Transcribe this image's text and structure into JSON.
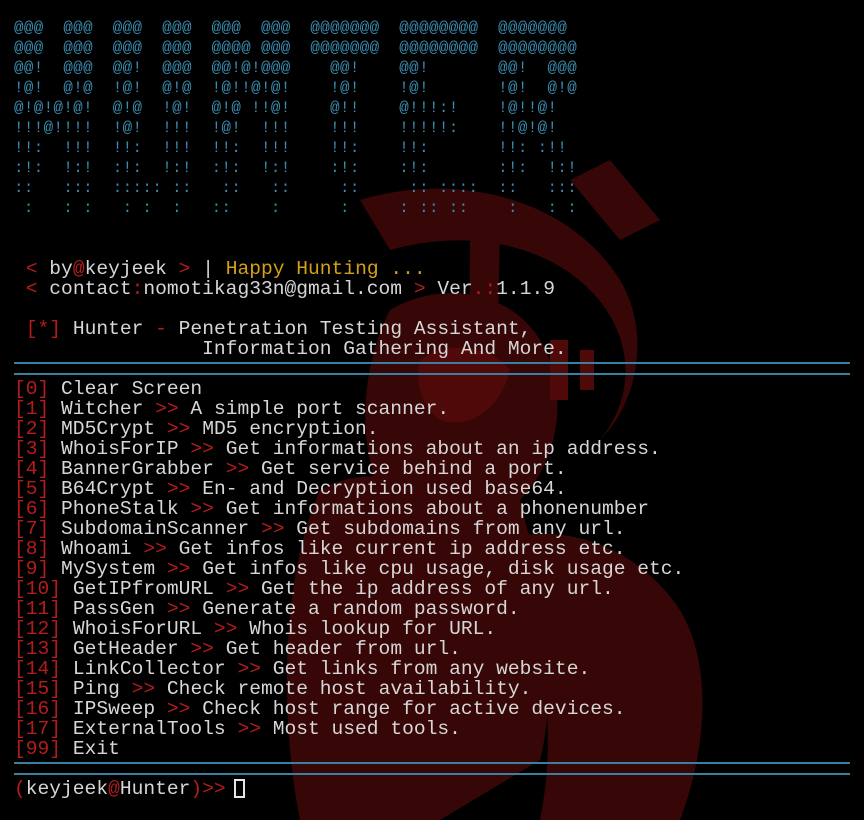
{
  "banner": {
    "lines": [
      "@@@  @@@  @@@  @@@  @@@  @@@  @@@@@@@  @@@@@@@@  @@@@@@@ ",
      "@@@  @@@  @@@  @@@  @@@@ @@@  @@@@@@@  @@@@@@@@  @@@@@@@@",
      "@@!  @@@  @@!  @@@  @@!@!@@@    @@!    @@!       @@!  @@@",
      "!@!  @!@  !@!  @!@  !@!!@!@!    !@!    !@!       !@!  @!@",
      "@!@!@!@!  @!@  !@!  @!@ !!@!    @!!    @!!!:!    !@!!@!  ",
      "!!!@!!!!  !@!  !!!  !@!  !!!    !!!    !!!!!:    !!@!@!  ",
      "!!:  !!!  !!:  !!!  !!:  !!!    !!:    !!:       !!: :!! ",
      ":!:  !:!  :!:  !:!  :!:  !:!    :!:    :!:       :!:  !:!",
      "::   :::  ::::: ::   ::   ::     ::     :: ::::  ::   :::",
      " :   : :   : :  :   ::    :      :     : :: ::    :   : :"
    ]
  },
  "info": {
    "lt": "<",
    "by": "by",
    "at": "@",
    "author": "keyjeek",
    "gt": ">",
    "pipe": "|",
    "tagline": "Happy Hunting ...",
    "contact_label": "contact",
    "colon": ":",
    "email": "nomotikag33n@gmail.com",
    "ver_label": "Ver",
    "ver_sep": ".:",
    "version": "1.1.9"
  },
  "description": {
    "marker": "[*]",
    "name": "Hunter",
    "dash": "-",
    "line1": "Penetration Testing Assistant,",
    "line2": "Information Gathering And More."
  },
  "menu": {
    "items": [
      {
        "num": "[0]",
        "label": "Clear Screen",
        "arrow": "",
        "desc": ""
      },
      {
        "num": "[1]",
        "label": "Witcher",
        "arrow": ">>",
        "desc": "A simple port scanner."
      },
      {
        "num": "[2]",
        "label": "MD5Crypt",
        "arrow": ">>",
        "desc": "MD5 encryption."
      },
      {
        "num": "[3]",
        "label": "WhoisForIP",
        "arrow": ">>",
        "desc": "Get informations about an ip address."
      },
      {
        "num": "[4]",
        "label": "BannerGrabber",
        "arrow": ">>",
        "desc": "Get service behind a port."
      },
      {
        "num": "[5]",
        "label": "B64Crypt",
        "arrow": ">>",
        "desc": "En- and Decryption used base64."
      },
      {
        "num": "[6]",
        "label": "PhoneStalk",
        "arrow": ">>",
        "desc": "Get informations about a phonenumber"
      },
      {
        "num": "[7]",
        "label": "SubdomainScanner",
        "arrow": ">>",
        "desc": "Get subdomains from any url."
      },
      {
        "num": "[8]",
        "label": "Whoami",
        "arrow": ">>",
        "desc": "Get infos like current ip address etc."
      },
      {
        "num": "[9]",
        "label": "MySystem",
        "arrow": ">>",
        "desc": "Get infos like cpu usage, disk usage etc."
      },
      {
        "num": "[10]",
        "label": "GetIPfromURL",
        "arrow": ">>",
        "desc": "Get the ip address of any url."
      },
      {
        "num": "[11]",
        "label": "PassGen",
        "arrow": ">>",
        "desc": "Generate a random password."
      },
      {
        "num": "[12]",
        "label": "WhoisForURL",
        "arrow": ">>",
        "desc": "Whois lookup for URL."
      },
      {
        "num": "[13]",
        "label": "GetHeader",
        "arrow": ">>",
        "desc": "Get header from url."
      },
      {
        "num": "[14]",
        "label": "LinkCollector",
        "arrow": ">>",
        "desc": "Get links from any website."
      },
      {
        "num": "[15]",
        "label": "Ping",
        "arrow": ">>",
        "desc": "Check remote host availability."
      },
      {
        "num": "[16]",
        "label": "IPSweep",
        "arrow": ">>",
        "desc": "Check host range for active devices."
      },
      {
        "num": "[17]",
        "label": "ExternalTools",
        "arrow": ">>",
        "desc": "Most used tools."
      },
      {
        "num": "[99]",
        "label": "Exit",
        "arrow": "",
        "desc": ""
      }
    ]
  },
  "prompt": {
    "open": "(",
    "user": "keyjeek",
    "at": "@",
    "host": "Hunter",
    "close": ")",
    "symbol": ">>"
  },
  "colors": {
    "background": "#000000",
    "banner": "#3a8db0",
    "accent_red": "#b41c1c",
    "tagline_yellow": "#d4a017",
    "text": "#d6d6d6",
    "separator": "#3b7ea0",
    "bg_art": "#5a0b0b"
  }
}
